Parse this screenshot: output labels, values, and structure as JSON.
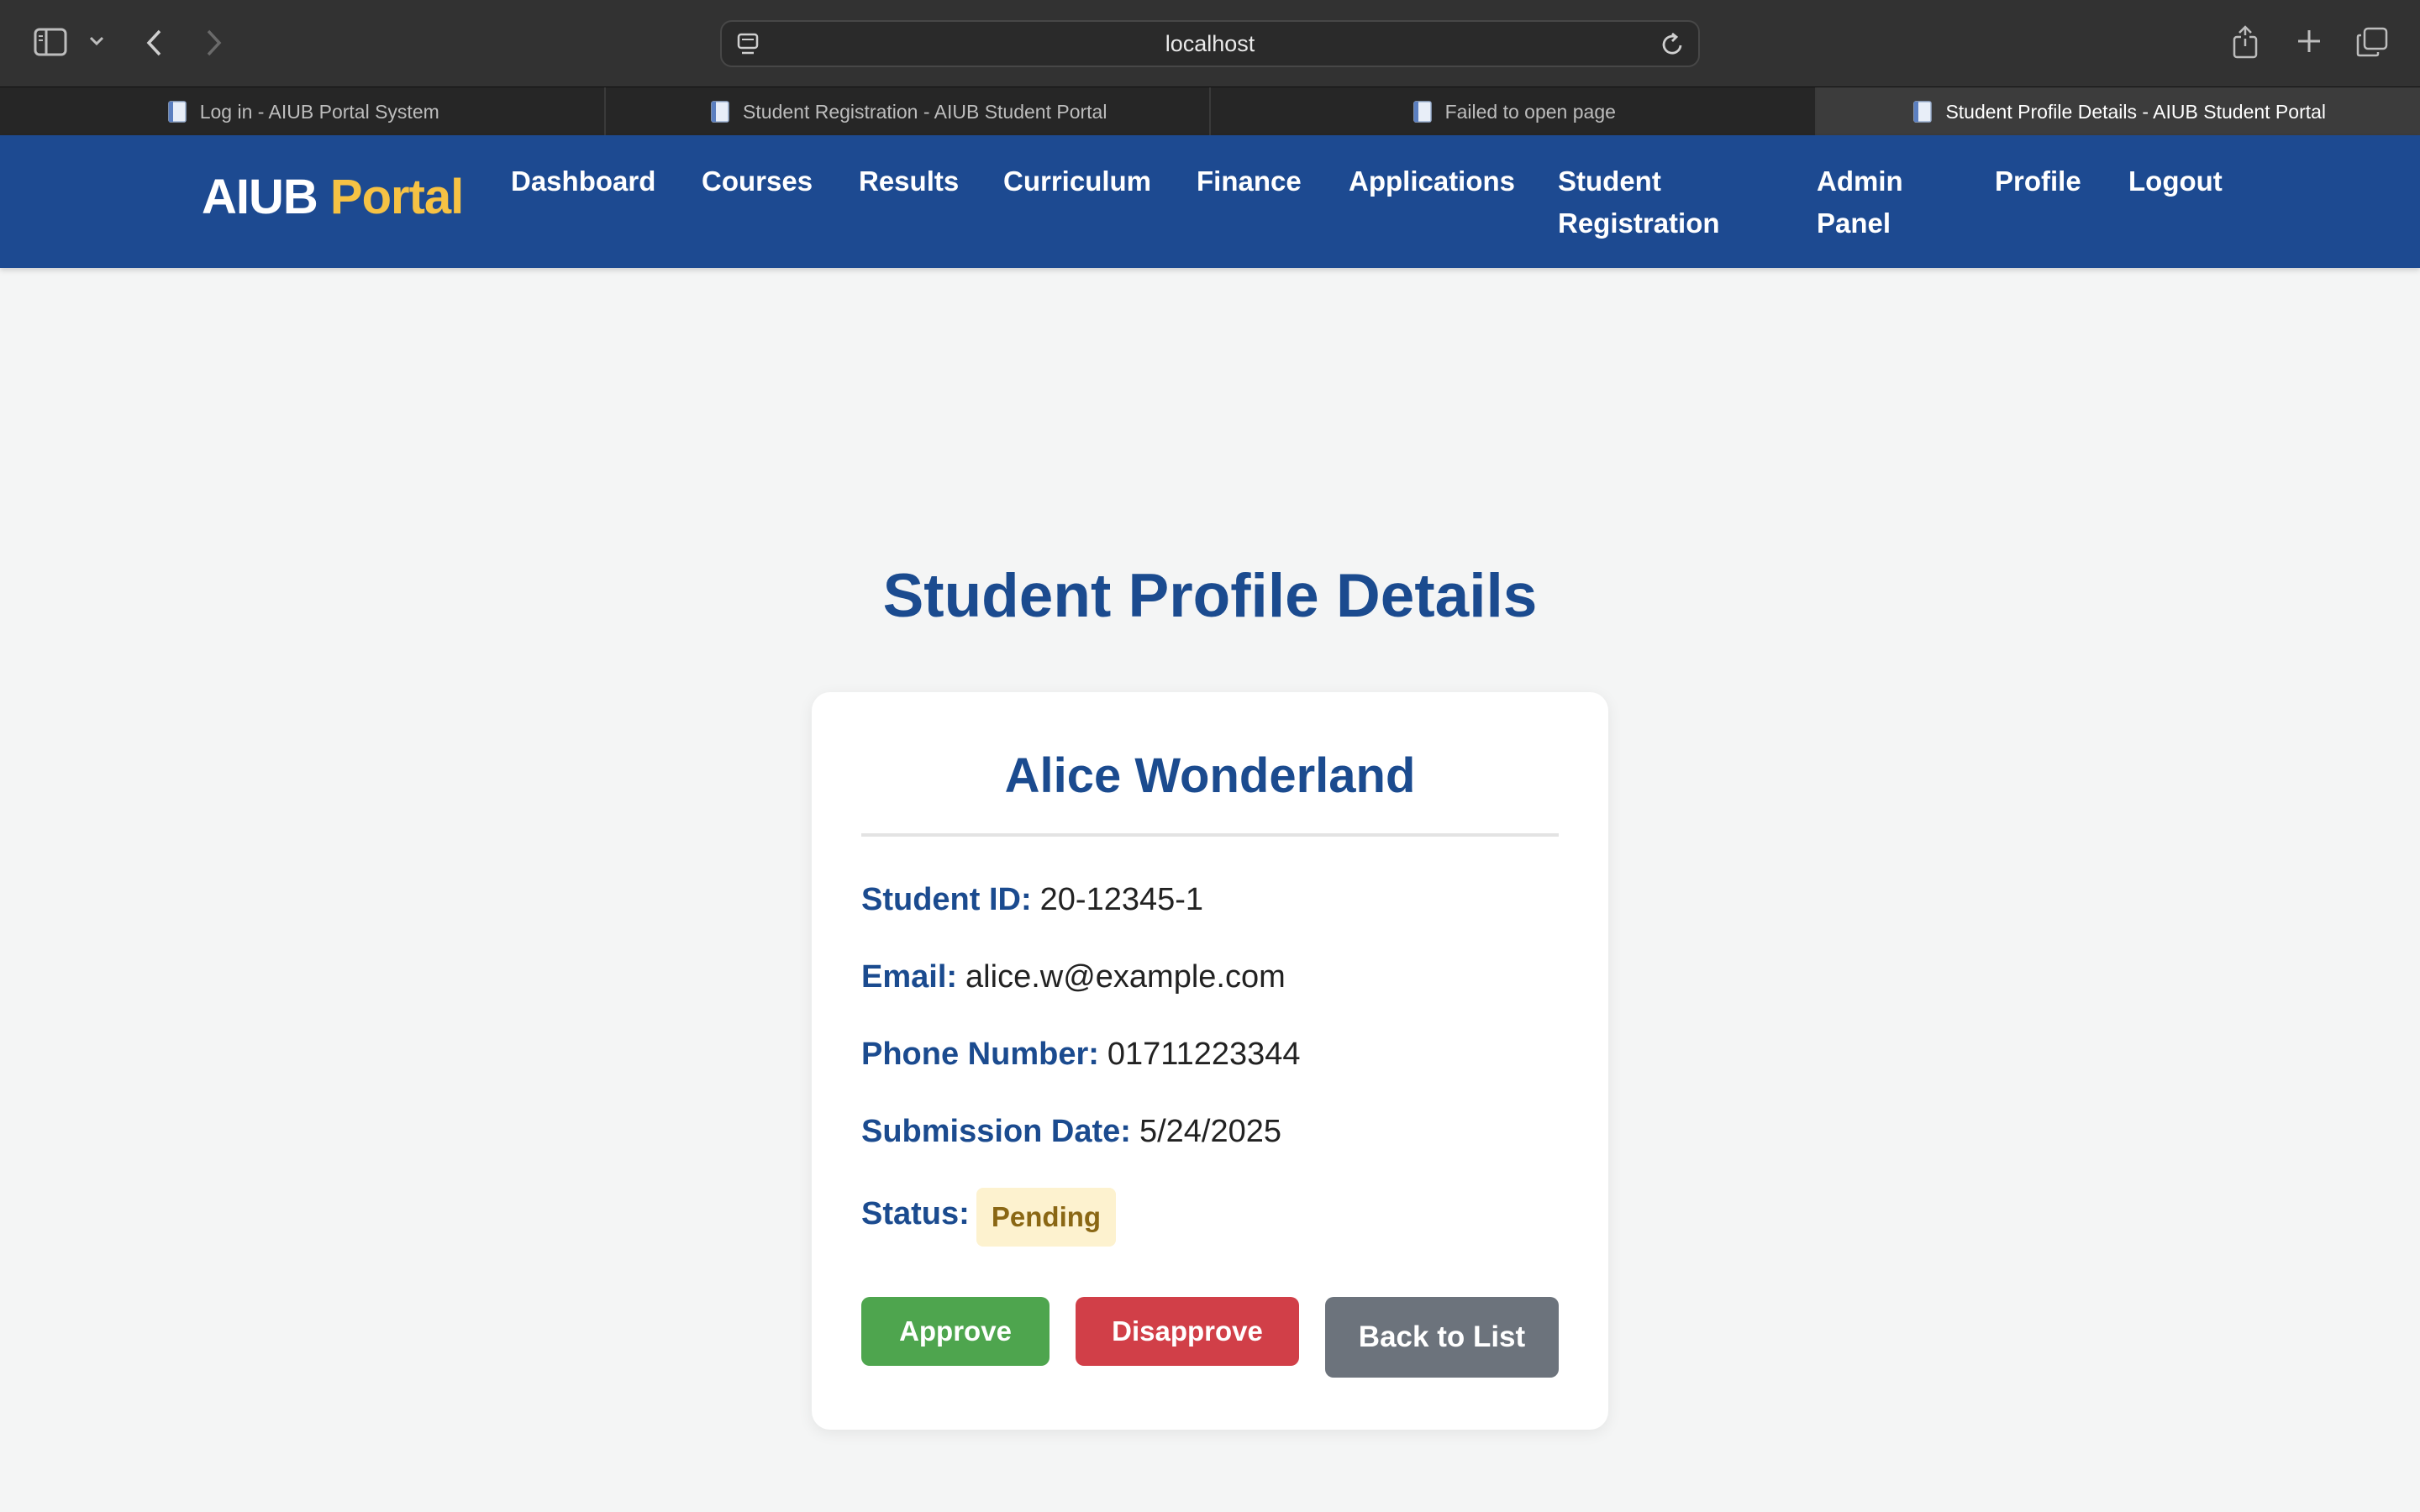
{
  "browser": {
    "url": "localhost",
    "tabs": [
      {
        "title": "Log in - AIUB Portal System",
        "active": false
      },
      {
        "title": "Student Registration - AIUB Student Portal",
        "active": false
      },
      {
        "title": "Failed to open page",
        "active": false
      },
      {
        "title": "Student Profile Details - AIUB Student Portal",
        "active": true
      }
    ]
  },
  "nav": {
    "brand_main": "AIUB",
    "brand_accent": "Portal",
    "items": [
      {
        "label": "Dashboard"
      },
      {
        "label": "Courses"
      },
      {
        "label": "Results"
      },
      {
        "label": "Curriculum"
      },
      {
        "label": "Finance"
      },
      {
        "label": "Applications"
      },
      {
        "label_line1": "Student",
        "label_line2": "Registration"
      },
      {
        "label_line1": "Admin",
        "label_line2": "Panel"
      },
      {
        "label": "Profile"
      },
      {
        "label": "Logout"
      }
    ]
  },
  "page": {
    "title": "Student Profile Details"
  },
  "profile": {
    "name": "Alice Wonderland",
    "fields": {
      "student_id_label": "Student ID:",
      "student_id": "20-12345-1",
      "email_label": "Email:",
      "email": "alice.w@example.com",
      "phone_label": "Phone Number:",
      "phone": "01711223344",
      "date_label": "Submission Date:",
      "date": "5/24/2025",
      "status_label": "Status:",
      "status": "Pending"
    },
    "actions": {
      "approve": "Approve",
      "disapprove": "Disapprove",
      "back": "Back to List"
    }
  },
  "colors": {
    "nav_bg": "#1d4a91",
    "brand_accent": "#f6c244",
    "heading": "#1b4b8f",
    "approve": "#4ea54e",
    "disapprove": "#d13f48",
    "back": "#6c737c",
    "pending_bg": "#fdf2cf"
  }
}
